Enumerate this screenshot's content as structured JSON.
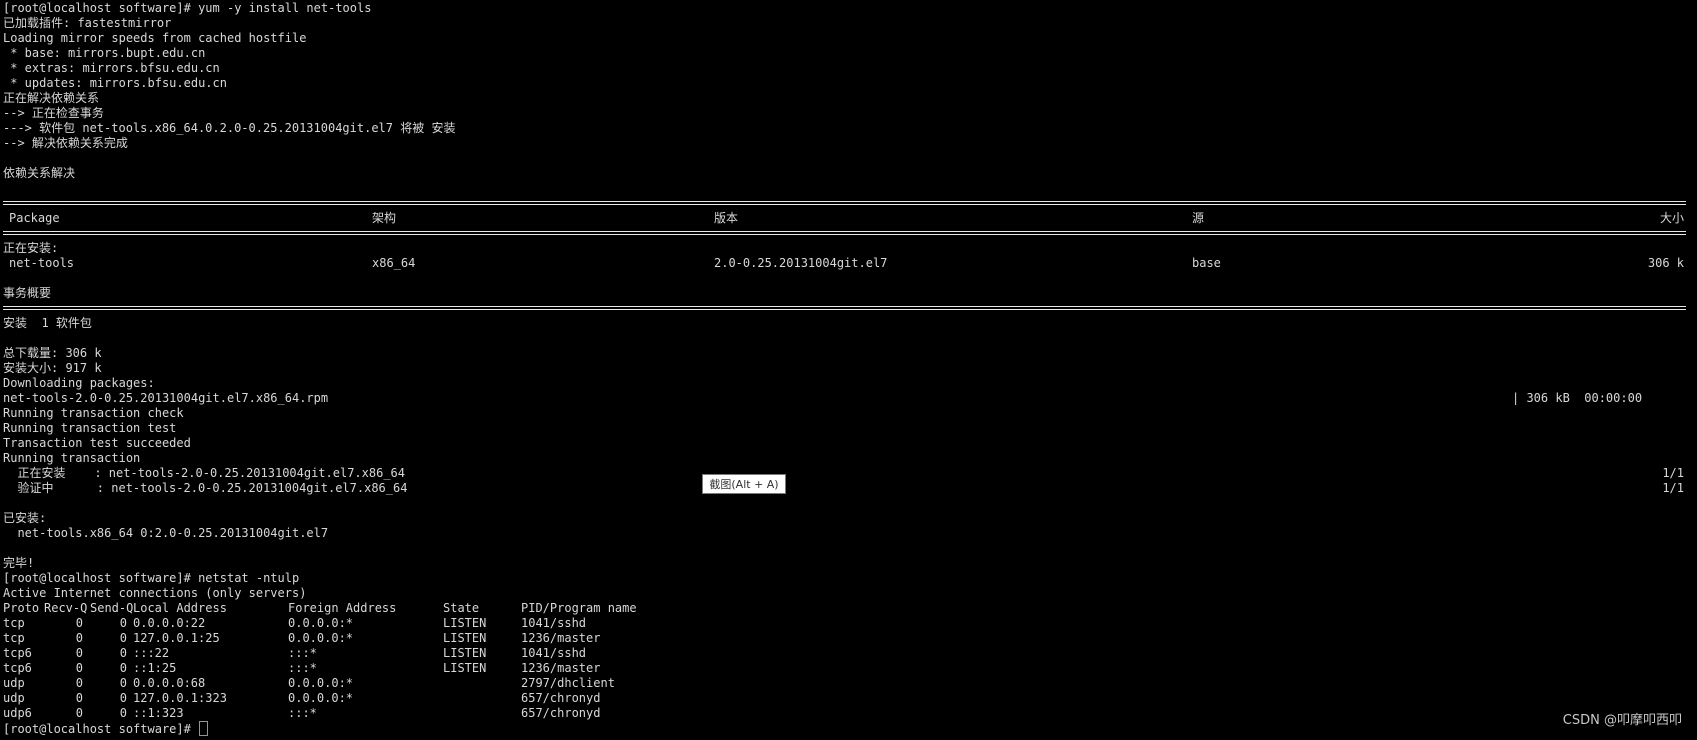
{
  "terminal": {
    "prompt1": "[root@localhost software]# yum -y install net-tools",
    "plugins": "已加载插件: fastestmirror",
    "loading": "Loading mirror speeds from cached hostfile",
    "mirror_base": " * base: mirrors.bupt.edu.cn",
    "mirror_extras": " * extras: mirrors.bfsu.edu.cn",
    "mirror_updates": " * updates: mirrors.bfsu.edu.cn",
    "resolving": "正在解决依赖关系",
    "checking": "--> 正在检查事务",
    "pkg_line": "---> 软件包 net-tools.x86_64.0.2.0-0.25.20131004git.el7 将被 安装",
    "resolve_done": "--> 解决依赖关系完成",
    "deps_resolved": "依赖关系解决",
    "table_header": {
      "package": "Package",
      "arch": "架构",
      "version": "版本",
      "repo": "源",
      "size": "大小"
    },
    "installing_label": "正在安装:",
    "table_row": {
      "package": "net-tools",
      "arch": "x86_64",
      "version": "2.0-0.25.20131004git.el7",
      "repo": "base",
      "size": "306 k"
    },
    "summary": "事务概要",
    "install_count": "安装  1 软件包",
    "total_download": "总下载量: 306 k",
    "installed_size": "安装大小: 917 k",
    "downloading": "Downloading packages:",
    "rpm_file": "net-tools-2.0-0.25.20131004git.el7.x86_64.rpm",
    "rpm_progress": "| 306 kB  00:00:00",
    "run_check": "Running transaction check",
    "run_test": "Running transaction test",
    "test_ok": "Transaction test succeeded",
    "running": "Running transaction",
    "installing_step": "  正在安装    : net-tools-2.0-0.25.20131004git.el7.x86_64",
    "installing_count": "1/1",
    "verifying_step": "  验证中      : net-tools-2.0-0.25.20131004git.el7.x86_64",
    "verifying_count": "1/1",
    "installed_label": "已安装:",
    "installed_pkg": "  net-tools.x86_64 0:2.0-0.25.20131004git.el7",
    "complete": "完毕!",
    "prompt2": "[root@localhost software]# netstat -ntulp",
    "active": "Active Internet connections (only servers)",
    "netstat_header": {
      "proto": "Proto",
      "recvq": "Recv-Q",
      "sendq": "Send-Q",
      "local": "Local Address",
      "foreign": "Foreign Address",
      "state": "State",
      "pid": "PID/Program name"
    },
    "netstat_rows": [
      {
        "proto": "tcp",
        "recvq": "0",
        "sendq": "0",
        "local": "0.0.0.0:22",
        "foreign": "0.0.0.0:*",
        "state": "LISTEN",
        "pid": "1041/sshd"
      },
      {
        "proto": "tcp",
        "recvq": "0",
        "sendq": "0",
        "local": "127.0.0.1:25",
        "foreign": "0.0.0.0:*",
        "state": "LISTEN",
        "pid": "1236/master"
      },
      {
        "proto": "tcp6",
        "recvq": "0",
        "sendq": "0",
        "local": ":::22",
        "foreign": ":::*",
        "state": "LISTEN",
        "pid": "1041/sshd"
      },
      {
        "proto": "tcp6",
        "recvq": "0",
        "sendq": "0",
        "local": "::1:25",
        "foreign": ":::*",
        "state": "LISTEN",
        "pid": "1236/master"
      },
      {
        "proto": "udp",
        "recvq": "0",
        "sendq": "0",
        "local": "0.0.0.0:68",
        "foreign": "0.0.0.0:*",
        "state": "",
        "pid": "2797/dhclient"
      },
      {
        "proto": "udp",
        "recvq": "0",
        "sendq": "0",
        "local": "127.0.0.1:323",
        "foreign": "0.0.0.0:*",
        "state": "",
        "pid": "657/chronyd"
      },
      {
        "proto": "udp6",
        "recvq": "0",
        "sendq": "0",
        "local": "::1:323",
        "foreign": ":::*",
        "state": "",
        "pid": "657/chronyd"
      }
    ],
    "prompt3": "[root@localhost software]# "
  },
  "tooltip": {
    "label": "截图(Alt + A)"
  },
  "watermark": {
    "text": "CSDN @叩摩叩西叩"
  },
  "colors": {
    "background": "#000000",
    "text": "#d8d8d8",
    "cursor": "#3ad43a"
  }
}
